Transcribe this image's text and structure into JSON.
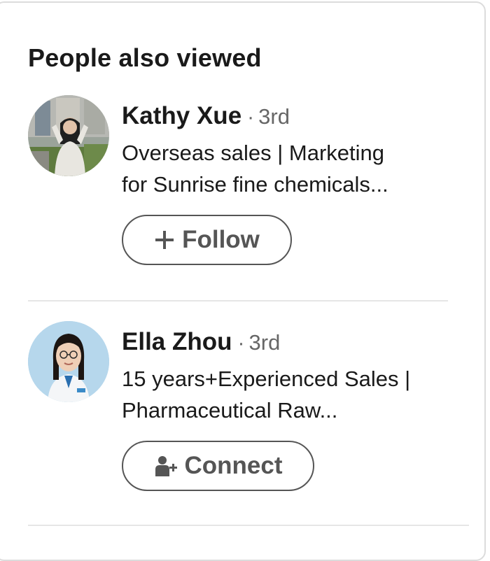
{
  "section": {
    "title": "People also viewed"
  },
  "people": [
    {
      "name": "Kathy Xue",
      "separator": "·",
      "degree": "3rd",
      "headline_lines": [
        "Overseas sales | Marketing",
        "for Sunrise fine chemicals..."
      ],
      "action": {
        "icon": "plus-icon",
        "label": "Follow"
      }
    },
    {
      "name": "Ella Zhou",
      "separator": "·",
      "degree": "3rd",
      "headline_lines": [
        "15 years+Experienced Sales |",
        "Pharmaceutical Raw..."
      ],
      "action": {
        "icon": "person-add-icon",
        "label": "Connect"
      }
    }
  ],
  "colors": {
    "text_primary": "#1a1a1a",
    "text_secondary": "#666666",
    "button_border": "#555555",
    "divider": "#e6e6e6"
  }
}
